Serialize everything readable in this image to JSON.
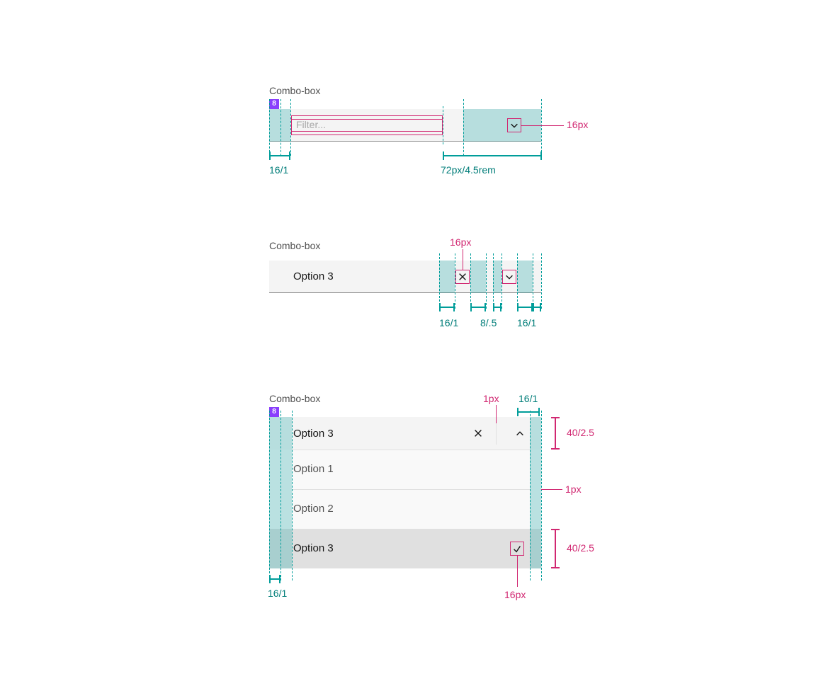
{
  "sections": {
    "s1": {
      "title": "Combo-box",
      "badge": "8",
      "input_placeholder": "Filter...",
      "left_pad_label": "16/1",
      "trigger_width_label": "72px/4.5rem",
      "chevron_label": "16px"
    },
    "s2": {
      "title": "Combo-box",
      "selected": "Option 3",
      "icon_size_label": "16px",
      "gap_left": "16/1",
      "gap_mid": "8/.5",
      "gap_right": "16/1"
    },
    "s3": {
      "title": "Combo-box",
      "badge": "8",
      "selected": "Option 3",
      "options": [
        "Option 1",
        "Option 2",
        "Option 3"
      ],
      "divider_label": "1px",
      "top_right_label": "16/1",
      "row_height_label": "40/2.5",
      "list_divider_label": "1px",
      "check_label": "16px",
      "bottom_left_label": "16/1"
    }
  }
}
